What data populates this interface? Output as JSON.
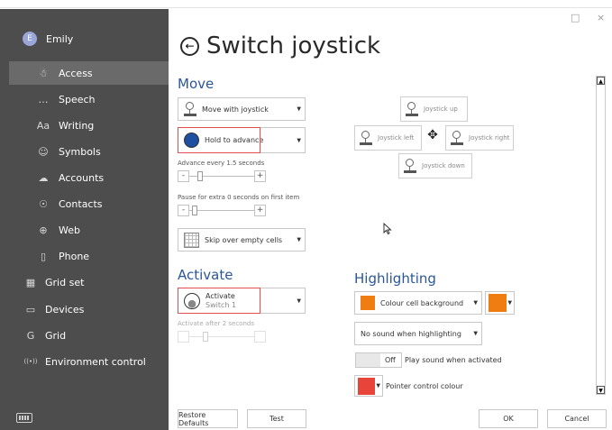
{
  "sidebar": {
    "user": {
      "initial": "E",
      "name": "Emily"
    },
    "items": [
      {
        "label": "Access",
        "icon": "accessibility-icon",
        "glyph": "☃"
      },
      {
        "label": "Speech",
        "icon": "speech-bubble-icon",
        "glyph": "…"
      },
      {
        "label": "Writing",
        "icon": "writing-icon",
        "glyph": "Aa"
      },
      {
        "label": "Symbols",
        "icon": "symbols-icon",
        "glyph": "☺"
      },
      {
        "label": "Accounts",
        "icon": "cloud-icon",
        "glyph": "☁"
      },
      {
        "label": "Contacts",
        "icon": "contacts-icon",
        "glyph": "☉"
      },
      {
        "label": "Web",
        "icon": "globe-icon",
        "glyph": "⊕"
      },
      {
        "label": "Phone",
        "icon": "phone-icon",
        "glyph": "▯"
      }
    ],
    "top_items": [
      {
        "label": "Grid set",
        "icon": "grid-set-icon",
        "glyph": "▦"
      },
      {
        "label": "Devices",
        "icon": "monitor-icon",
        "glyph": "▭"
      },
      {
        "label": "Grid",
        "icon": "grid-g-icon",
        "glyph": "G"
      },
      {
        "label": "Environment control",
        "icon": "wireless-icon",
        "glyph": "((•))"
      }
    ]
  },
  "window": {
    "maximize_glyph": "□",
    "close_glyph": "×"
  },
  "page": {
    "title": "Switch joystick",
    "back_glyph": "←"
  },
  "move": {
    "heading": "Move",
    "mode": "Move with joystick",
    "advance": "Hold to advance",
    "advance_every_label": "Advance every 1.5 seconds",
    "pause_label": "Pause for extra 0 seconds on first item",
    "skip": "Skip over empty cells"
  },
  "joystick": {
    "up": "Joystick up",
    "left": "Joystick left",
    "right": "Joystick right",
    "down": "Joystick down",
    "move_glyph": "✥"
  },
  "activate": {
    "heading": "Activate",
    "title": "Activate",
    "subtitle": "Switch 1",
    "after_label": "Activate after 2 seconds"
  },
  "highlighting": {
    "heading": "Highlighting",
    "mode": "Colour cell background",
    "highlight_color": "#f07d12",
    "sound": "No sound when highlighting",
    "toggle_state": "Off",
    "toggle_label": "Play sound when activated",
    "pointer_color": "#e8443a",
    "pointer_label": "Pointer control colour"
  },
  "stepper": {
    "minus": "-",
    "plus": "+"
  },
  "buttons": {
    "restore": "Restore Defaults",
    "test": "Test",
    "ok": "OK",
    "cancel": "Cancel"
  },
  "colors": {
    "sidebar_bg": "#4d4d4d",
    "sidebar_active": "#6a6a6a",
    "section_heading": "#2b5797",
    "highlight_border": "#e34d4d"
  }
}
